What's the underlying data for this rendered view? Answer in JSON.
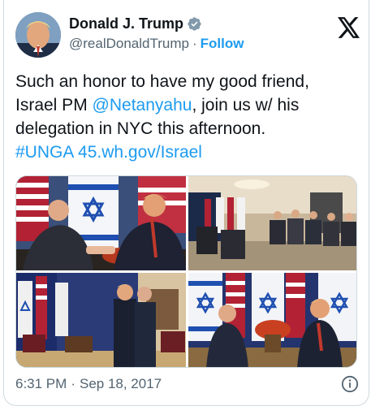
{
  "user": {
    "display_name": "Donald J. Trump",
    "handle": "@realDonaldTrump",
    "follow_label": "Follow",
    "separator": "·"
  },
  "tweet": {
    "line1": "Such an honor to have my good friend,",
    "line2_prefix": "Israel PM ",
    "mention": "@Netanyahu",
    "line2_suffix": ", join us w/ his",
    "line3": "delegation in NYC this afternoon.",
    "hashtag": "#UNGA",
    "url": "45.wh.gov/Israel"
  },
  "footer": {
    "time": "6:31 PM",
    "separator": "·",
    "date": "Sep 18, 2017"
  },
  "colors": {
    "accent": "#1d9bf0",
    "text": "#0f1419",
    "secondary": "#536471",
    "border": "#cfd9de"
  },
  "icons": [
    "verified-badge-icon",
    "x-logo-icon",
    "info-icon"
  ]
}
